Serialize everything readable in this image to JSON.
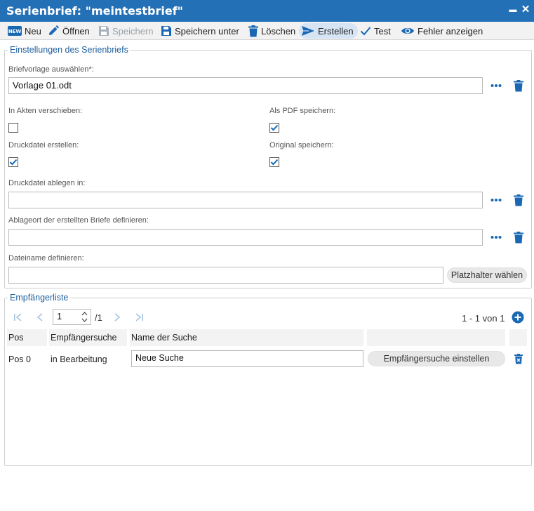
{
  "window": {
    "title": "Serienbrief: \"meintestbrief\"",
    "minimize_label": "▬",
    "close_label": "✕"
  },
  "toolbar": {
    "neu": "Neu",
    "oeffnen": "Öffnen",
    "speichern": "Speichern",
    "speichern_unter": "Speichern unter",
    "loeschen": "Löschen",
    "erstellen": "Erstellen",
    "test": "Test",
    "fehler_anzeigen": "Fehler anzeigen",
    "new_badge": "NEW"
  },
  "settings": {
    "legend": "Einstellungen des Serienbriefs",
    "briefvorlage_label": "Briefvorlage auswählen*:",
    "briefvorlage_value": "Vorlage 01.odt",
    "in_akten_label": "In Akten verschieben:",
    "in_akten_checked": false,
    "als_pdf_label": "Als PDF speichern:",
    "als_pdf_checked": true,
    "druckdatei_erstellen_label": "Druckdatei erstellen:",
    "druckdatei_erstellen_checked": true,
    "original_label": "Original speichern:",
    "original_checked": true,
    "druckdatei_ablegen_label": "Druckdatei ablegen in:",
    "druckdatei_ablegen_value": "",
    "ablageort_label": "Ablageort der erstellten Briefe definieren:",
    "ablageort_value": "",
    "dateiname_label": "Dateiname definieren:",
    "dateiname_value": "",
    "platzhalter_button": "Platzhalter wählen"
  },
  "recipients": {
    "legend": "Empfängerliste",
    "page_value": "1",
    "page_total": "/1",
    "range_text": "1 - 1 von 1",
    "columns": [
      "Pos",
      "Empfängersuche",
      "Name der Suche"
    ],
    "rows": [
      {
        "pos": "Pos 0",
        "status": "in Bearbeitung",
        "search_name": "Neue Suche",
        "action_label": "Empfängersuche einstellen"
      }
    ]
  },
  "colors": {
    "titlebar": "#2470b6",
    "accent": "#1a68b3",
    "toolbar_bg": "#f2f2f2"
  }
}
